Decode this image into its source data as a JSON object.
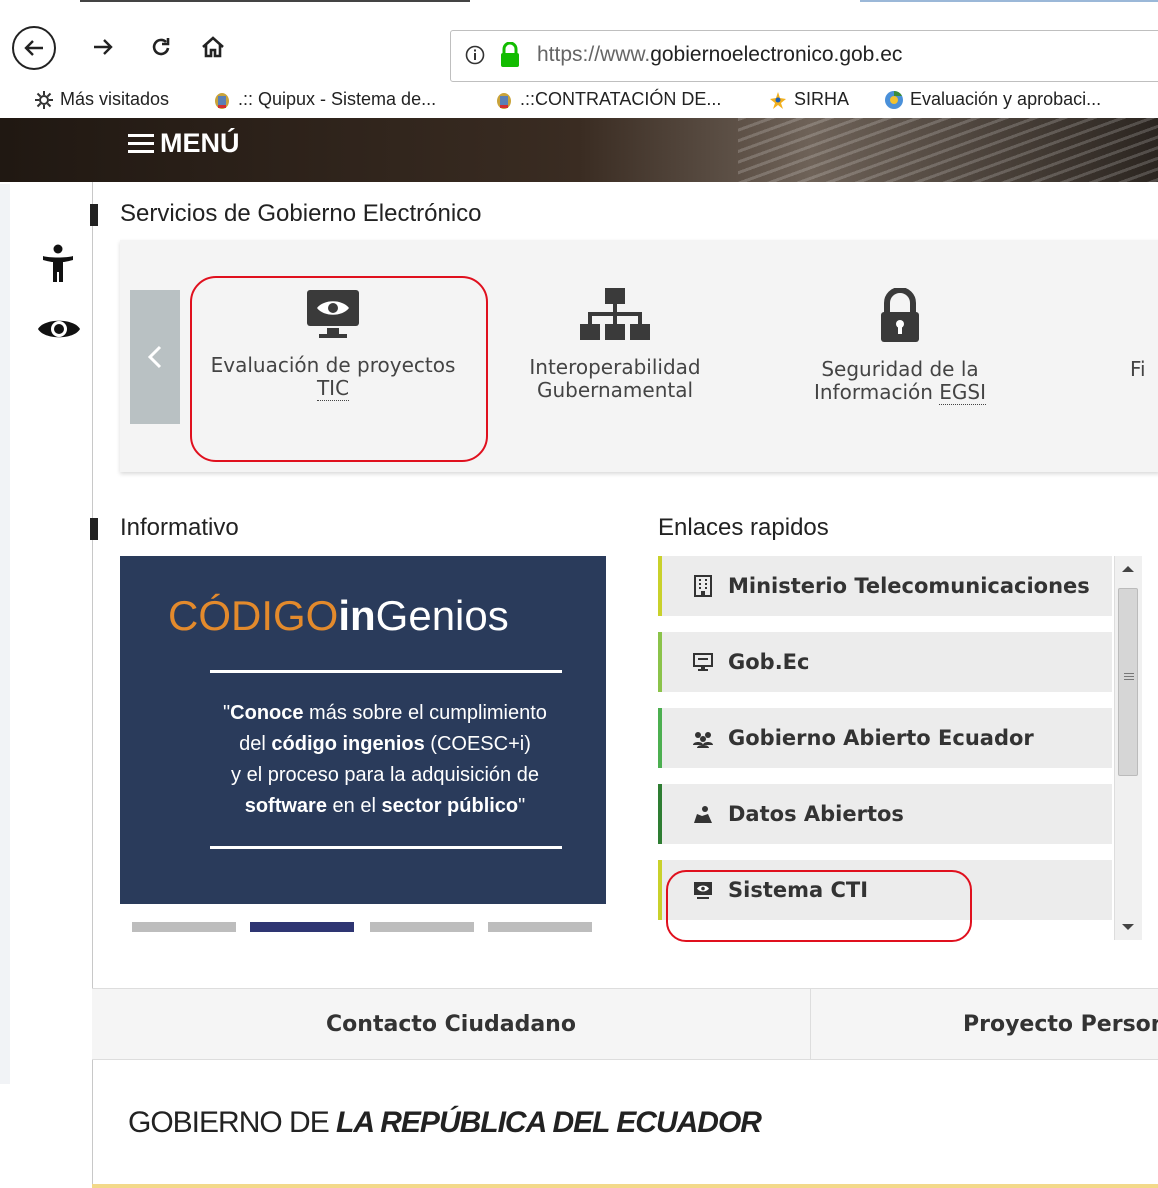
{
  "browser": {
    "url_scheme": "https://www.",
    "url_host": "gobiernoelectronico.gob.ec",
    "bookmarks": [
      {
        "label": "Más visitados",
        "icon": "gear-icon"
      },
      {
        "label": ".:: Quipux - Sistema de...",
        "icon": "ecuador-seal-icon"
      },
      {
        "label": ".::CONTRATACIÓN DE...",
        "icon": "ecuador-seal-icon"
      },
      {
        "label": "SIRHA",
        "icon": "sirha-star-icon"
      },
      {
        "label": "Evaluación y aprobaci...",
        "icon": "chrome-globe-icon"
      }
    ]
  },
  "header": {
    "menu_label": "MENÚ"
  },
  "services": {
    "title": "Servicios de Gobierno Electrónico",
    "items": [
      {
        "line1": "Evaluación de proyectos",
        "line2": "TIC",
        "icon": "monitor-eye-icon"
      },
      {
        "line1": "Interoperabilidad",
        "line2": "Gubernamental",
        "icon": "org-chart-icon"
      },
      {
        "line1": "Seguridad de la",
        "line2a": "Información ",
        "line2b": "EGSI",
        "icon": "padlock-icon"
      },
      {
        "line1": "Fi",
        "icon": "partial-icon"
      }
    ]
  },
  "informativo": {
    "title": "Informativo",
    "banner": {
      "heading_a": "CÓDIGO",
      "heading_b": "in",
      "heading_c": "Genios",
      "q_open": "\"",
      "t1_bold": "Conoce",
      "t1": " más sobre el cumplimiento",
      "t2": "del ",
      "t2_bold": "código ingenios",
      "t2_end": " (COESC+i)",
      "t3": "y el proceso para la adquisición de",
      "t4_bold": "software",
      "t4": " en el ",
      "t4_bold2": "sector público",
      "q_close": "\""
    },
    "slides_active": 2
  },
  "enlaces": {
    "title": "Enlaces rapidos",
    "items": [
      {
        "label": "Ministerio Telecomunicaciones",
        "icon": "building-icon",
        "accent": "#c9d12b"
      },
      {
        "label": "Gob.Ec",
        "icon": "desktop-icon",
        "accent": "#8bc34a"
      },
      {
        "label": "Gobierno Abierto Ecuador",
        "icon": "users-icon",
        "accent": "#4caf50"
      },
      {
        "label": "Datos Abiertos",
        "icon": "map-user-icon",
        "accent": "#2e7d32"
      },
      {
        "label": "Sistema CTI",
        "icon": "monitor-eye-icon",
        "accent": "#c9d12b"
      }
    ]
  },
  "bottom_tabs": {
    "contacto": "Contacto Ciudadano",
    "proyecto": "Proyecto Persona"
  },
  "footer": {
    "logo_a": "GOBIERNO DE ",
    "logo_b": "LA REPÚBLICA DEL ECUADOR"
  },
  "colors": {
    "highlight_red": "#e0101e",
    "banner_bg": "#2a3b5b",
    "banner_orange": "#e38a2c",
    "active_dot": "#2e3572"
  }
}
